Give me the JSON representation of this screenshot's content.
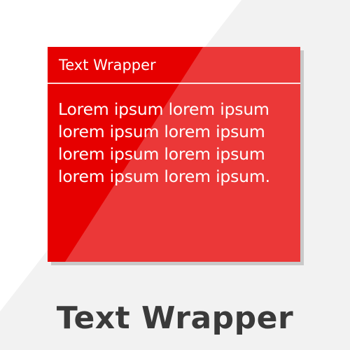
{
  "card": {
    "title": "Text Wrapper",
    "body_lines": [
      "Lorem ipsum lorem ipsum",
      "lorem ipsum lorem ipsum",
      "lorem ipsum lorem ipsum",
      "lorem ipsum lorem ipsum."
    ]
  },
  "caption": "Text Wrapper",
  "colors": {
    "card_red": "#e60000",
    "background_gray": "#f2f2f2",
    "caption_text": "#3a3a3a"
  }
}
